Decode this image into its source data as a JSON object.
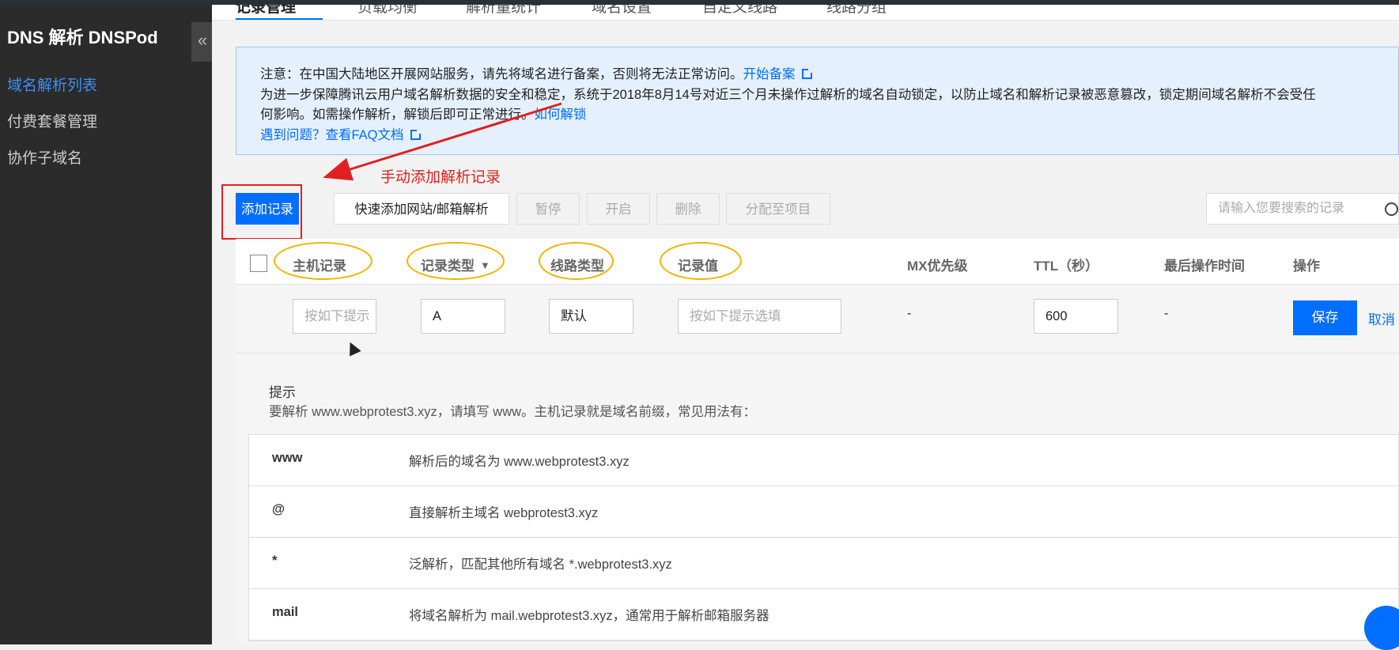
{
  "sidebar": {
    "title": "DNS 解析 DNSPod",
    "collapse_icon": "«",
    "items": [
      {
        "label": "域名解析列表",
        "active": true
      },
      {
        "label": "付费套餐管理",
        "active": false
      },
      {
        "label": "协作子域名",
        "active": false
      }
    ]
  },
  "tabs": [
    {
      "label": "记录管理",
      "active": true
    },
    {
      "label": "负载均衡"
    },
    {
      "label": "解析量统计"
    },
    {
      "label": "域名设置"
    },
    {
      "label": "自定义线路"
    },
    {
      "label": "线路分组"
    }
  ],
  "notice": {
    "line1": "注意：在中国大陆地区开展网站服务，请先将域名进行备案，否则将无法正常访问。",
    "line1_link": "开始备案",
    "line2": "为进一步保障腾讯云用户域名解析数据的安全和稳定，系统于2018年8月14号对近三个月未操作过解析的域名自动锁定，以防止域名和解析记录被恶意篡改，锁定期间域名解析不会受任",
    "line3": "何影响。如需操作解析，解锁后即可正常进行。",
    "line3_link": "如何解锁",
    "line4_link": "遇到问题？查看FAQ文档",
    "close_icon": "✕"
  },
  "annotation": "手动添加解析记录",
  "toolbar": {
    "add_record": "添加记录",
    "quick_add": "快速添加网站/邮箱解析",
    "pause": "暂停",
    "enable": "开启",
    "delete": "删除",
    "assign_project": "分配至项目",
    "search_placeholder": "请输入您要搜索的记录"
  },
  "table": {
    "headers": {
      "host": "主机记录",
      "type": "记录类型",
      "line": "线路类型",
      "value": "记录值",
      "mx": "MX优先级",
      "ttl": "TTL（秒）",
      "last_op": "最后操作时间",
      "action": "操作"
    },
    "edit_row": {
      "host_placeholder": "按如下提示",
      "type": "A",
      "line": "默认",
      "value_placeholder": "按如下提示选填",
      "mx": "-",
      "ttl": "600",
      "last_op": "-",
      "save": "保存",
      "cancel": "取消"
    }
  },
  "tips": {
    "title": "提示",
    "desc": "要解析 www.webprotest3.xyz，请填写 www。主机记录就是域名前缀，常见用法有：",
    "rows": [
      {
        "key": "www",
        "desc": "解析后的域名为 www.webprotest3.xyz"
      },
      {
        "key": "@",
        "desc": "直接解析主域名 webprotest3.xyz"
      },
      {
        "key": "*",
        "desc": "泛解析，匹配其他所有域名 *.webprotest3.xyz"
      },
      {
        "key": "mail",
        "desc": "将域名解析为 mail.webprotest3.xyz，通常用于解析邮箱服务器"
      }
    ]
  },
  "colors": {
    "primary": "#006eff",
    "annotation": "#e02020",
    "highlight_oval": "#f0b400",
    "sidebar_bg": "#2b2b2b"
  }
}
